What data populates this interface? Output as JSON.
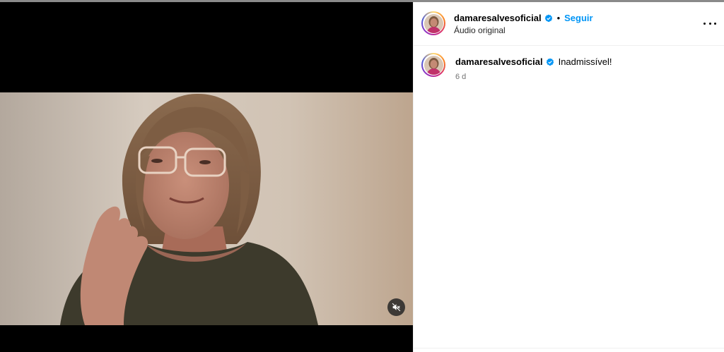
{
  "post": {
    "username": "damaresalvesoficial",
    "follow_label": "Seguir",
    "audio_label": "Áudio original",
    "caption": "Inadmissível!",
    "time_ago": "6 d",
    "separator": "•"
  },
  "icons": {
    "verified": "verified-badge-icon",
    "more": "more-options-icon",
    "mute": "muted-speaker-icon"
  },
  "colors": {
    "link_blue": "#0095f6",
    "verified_blue": "#0095f6",
    "meta_gray": "#737373"
  }
}
